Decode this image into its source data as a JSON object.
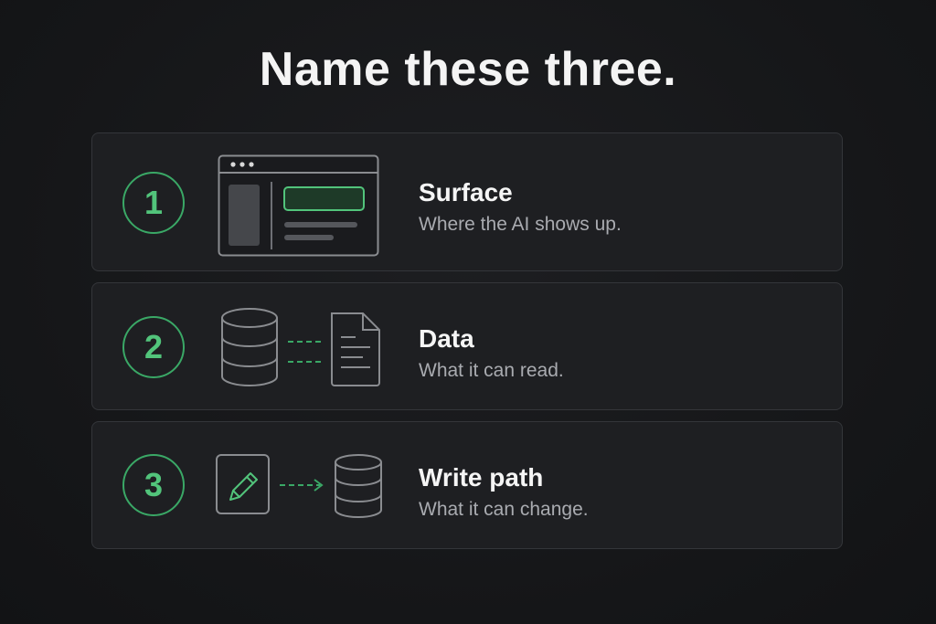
{
  "title": "Name these three.",
  "colors": {
    "accent": "#52c47b",
    "background": "#151618",
    "card": "#1e1f22",
    "outline": "#8a8c90"
  },
  "items": [
    {
      "number": "1",
      "heading": "Surface",
      "subtitle": "Where the AI shows up.",
      "icon": "app-window-icon"
    },
    {
      "number": "2",
      "heading": "Data",
      "subtitle": "What it can read.",
      "icon": "database-to-document-icon"
    },
    {
      "number": "3",
      "heading": "Write path",
      "subtitle": "What it can change.",
      "icon": "edit-to-database-icon"
    }
  ]
}
